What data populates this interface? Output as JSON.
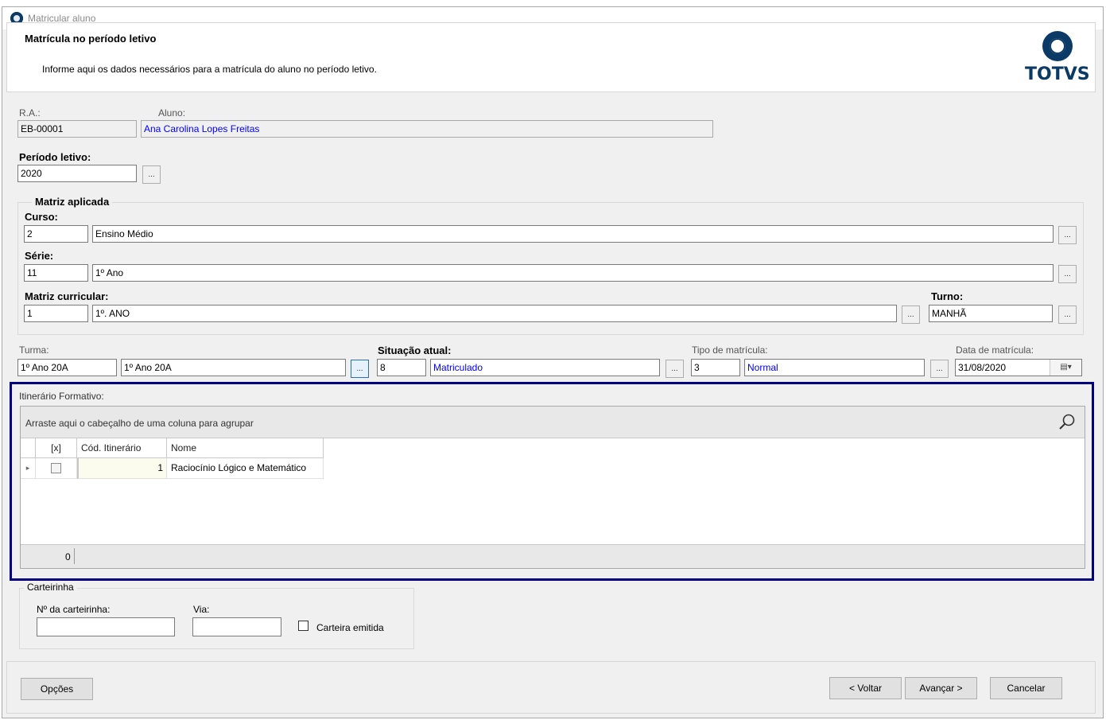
{
  "window": {
    "title": "Matricular aluno"
  },
  "header": {
    "title": "Matrícula no período letivo",
    "subtitle": "Informe aqui os dados necessários para a matrícula do aluno no período letivo.",
    "logo_text": "TOTVS"
  },
  "student": {
    "ra_label": "R.A.:",
    "ra_value": "EB-00001",
    "aluno_label": "Aluno:",
    "aluno_value": "Ana Carolina Lopes Freitas"
  },
  "periodo": {
    "label": "Período letivo:",
    "value": "2020",
    "lookup": "..."
  },
  "matriz": {
    "group_title": "Matriz aplicada",
    "curso_label": "Curso:",
    "curso_code": "2",
    "curso_name": "Ensino Médio",
    "serie_label": "Série:",
    "serie_code": "11",
    "serie_name": "1º Ano",
    "matriz_label": "Matriz curricular:",
    "matriz_code": "1",
    "matriz_name": "1º. ANO",
    "turno_label": "Turno:",
    "turno_value": "MANHÃ",
    "lookup": "..."
  },
  "turma": {
    "label": "Turma:",
    "code": "1º Ano 20A",
    "name": "1º Ano 20A"
  },
  "situacao": {
    "label": "Situação atual:",
    "code": "8",
    "name": "Matriculado"
  },
  "tipo": {
    "label": "Tipo de matrícula:",
    "code": "3",
    "name": "Normal"
  },
  "data_matricula": {
    "label": "Data de matrícula:",
    "value": "31/08/2020"
  },
  "itinerario": {
    "label": "Itinerário Formativo:",
    "group_hint": "Arraste aqui o cabeçalho de uma coluna para agrupar",
    "columns": [
      "[x]",
      "Cód. Itinerário",
      "Nome"
    ],
    "rows": [
      {
        "checked": false,
        "codigo": "1",
        "nome": "Raciocínio Lógico e Matemático"
      }
    ],
    "footer_count": "0"
  },
  "carteirinha": {
    "group_title": "Carteirinha",
    "numero_label": "Nº da carteirinha:",
    "numero_value": "",
    "via_label": "Via:",
    "via_value": "",
    "emitida_label": "Carteira emitida",
    "emitida_checked": false
  },
  "buttons": {
    "opcoes": "Opções",
    "voltar": "< Voltar",
    "avancar": "Avançar >",
    "cancelar": "Cancelar"
  },
  "colors": {
    "accent": "#00007f",
    "blue_text": "#0000ff",
    "brand": "#0b3a66"
  }
}
